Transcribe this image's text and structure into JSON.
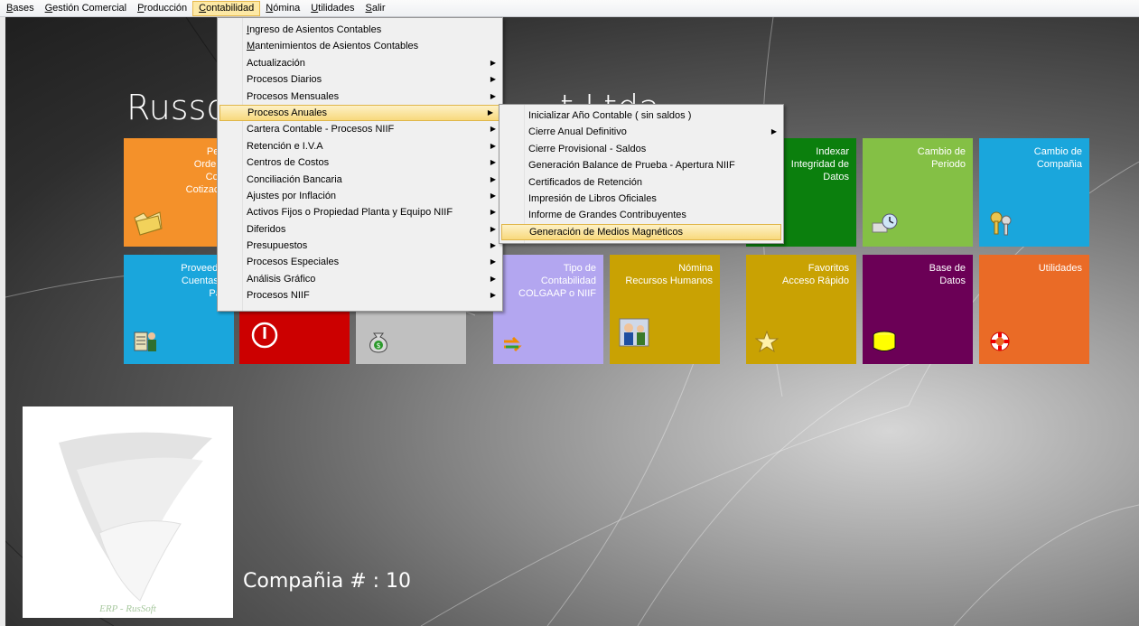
{
  "menubar": [
    "Bases",
    "Gestión Comercial",
    "Producción",
    "Contabilidad",
    "Nómina",
    "Utilidades",
    "Salir"
  ],
  "company_title_left": "Russo",
  "company_title_right": "t Ltda.",
  "company_number": "Compañia # : 10",
  "logo_text": "ERP - RusSoft",
  "tiles": {
    "pedidos": "Pedid\nOrdenes \nComp\nCotizacion",
    "indexar": "Indexar\nIntegridad de\nDatos",
    "cambio_periodo": "Cambio de\nPeriodo",
    "cambio_compania": "Cambio de\nCompañia",
    "proveedores": "Proveedor\nCuentas p\nPag",
    "tipo_contabilidad": "Tipo de\nContabilidad\nCOLGAAP o NIIF",
    "nomina": "Nómina\nRecursos Humanos",
    "favoritos": "Favoritos\nAcceso Rápido",
    "base_datos": "Base de\nDatos",
    "utilidades": "Utilidades"
  },
  "contabilidad_menu": [
    "Ingreso de Asientos Contables",
    "Mantenimientos de Asientos Contables",
    "Actualización",
    "Procesos Diarios",
    "Procesos Mensuales",
    "Procesos Anuales",
    "Cartera Contable - Procesos NIIF",
    "Retención e I.V.A",
    "Centros de Costos",
    "Conciliación Bancaria",
    "Ajustes por Inflación",
    "Activos Fijos o Propiedad Planta y Equipo NIIF",
    "Diferidos",
    "Presupuestos",
    "Procesos Especiales",
    "Análisis Gráfico",
    "Procesos NIIF"
  ],
  "anuales_menu": [
    "Inicializar Año Contable ( sin saldos )",
    "Cierre Anual Definitivo",
    "Cierre Provisional - Saldos",
    "Generación Balance de Prueba - Apertura NIIF",
    "Certificados de Retención",
    "Impresión de Libros Oficiales",
    "Informe de Grandes Contribuyentes",
    "Generación de Medios Magnéticos"
  ],
  "arrow_glyph": "▶",
  "colors": {
    "orange": "#f4912a",
    "green": "#84c045",
    "cyan": "#1aa6dc",
    "darkgreen": "#0b7f0d",
    "red": "#cc0000",
    "gray": "#c0c0c0",
    "lavender": "#b3a6f0",
    "mustard": "#c9a203",
    "purple": "#6b0056",
    "tangerine": "#ea6b26",
    "menu_highlight": "#f8d97d"
  }
}
